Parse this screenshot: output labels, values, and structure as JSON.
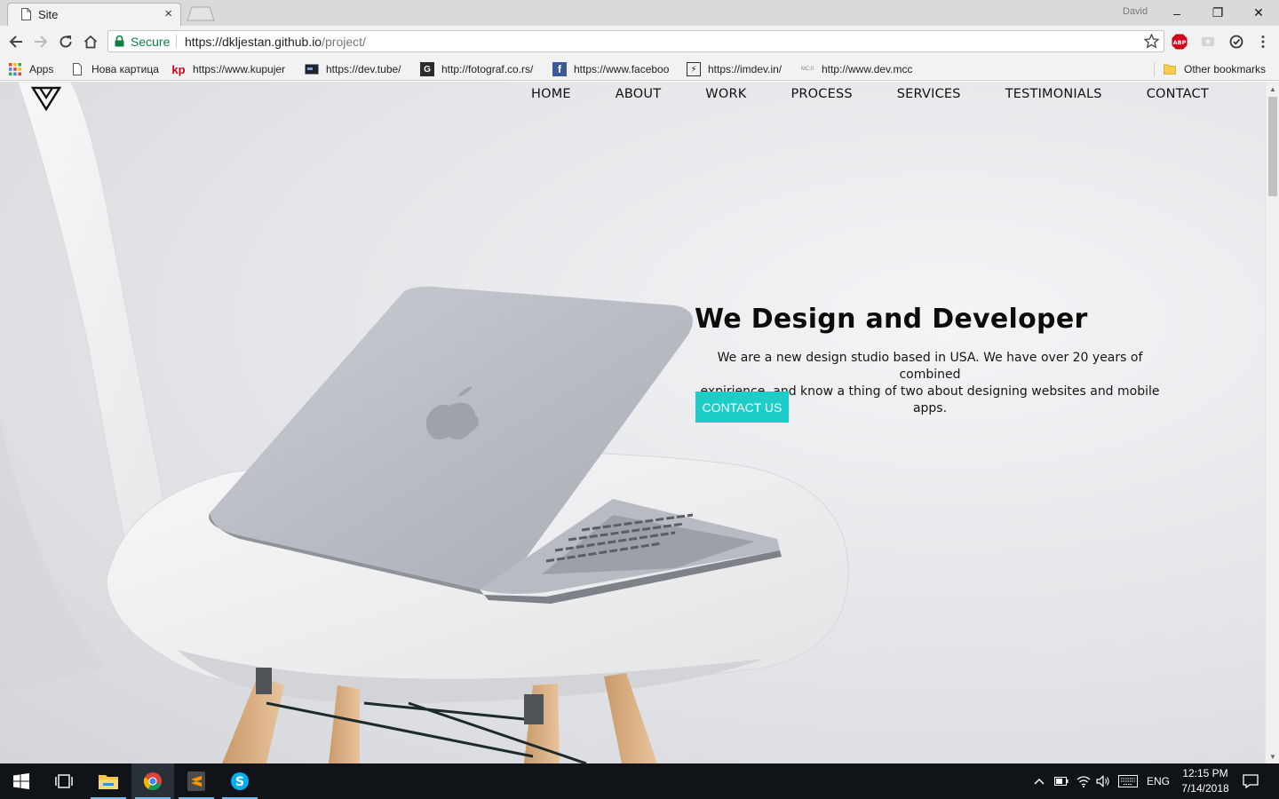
{
  "browser": {
    "tab": {
      "title": "Site",
      "close_glyph": "×",
      "icon": "document-icon"
    },
    "profile_name": "David",
    "window_controls": {
      "minimize": "–",
      "maximize": "❐",
      "close": "✕"
    },
    "address": {
      "secure_label": "Secure",
      "host": "https://dkljestan.github.io",
      "path": "/project/"
    },
    "bookmarks": [
      {
        "label": "Apps",
        "icon": "apps-grid-icon"
      },
      {
        "label": "Нова картица",
        "icon": "page-icon"
      },
      {
        "label": "https://www.kupujer",
        "icon": "kp-icon",
        "fav_text": "kp"
      },
      {
        "label": "https://dev.tube/",
        "icon": "devtube-icon"
      },
      {
        "label": "http://fotograf.co.rs/",
        "icon": "fotograf-icon",
        "fav_text": "G"
      },
      {
        "label": "https://www.faceboo",
        "icon": "facebook-icon",
        "fav_text": "f"
      },
      {
        "label": "https://imdev.in/",
        "icon": "imdev-icon",
        "fav_text": "⚡"
      },
      {
        "label": "http://www.dev.mcc",
        "icon": "mcc-icon",
        "fav_text": "MC.0"
      }
    ],
    "other_bookmarks": "Other bookmarks"
  },
  "site": {
    "nav": [
      "HOME",
      "ABOUT",
      "WORK",
      "PROCESS",
      "SERVICES",
      "TESTIMONIALS",
      "CONTACT"
    ],
    "hero": {
      "title": "We Design and Developer",
      "line1": "We are a new design studio based in USA. We have over 20 years of combined",
      "line2": "expirience, and know a thing of two about designing websites and mobile apps.",
      "cta": "CONTACT US"
    },
    "accent": "#1ccdc8"
  },
  "taskbar": {
    "language": "ENG",
    "time": "12:15 PM",
    "date": "7/14/2018",
    "apps": [
      "start-icon",
      "task-view-icon",
      "file-explorer-icon",
      "chrome-icon",
      "sublime-text-icon",
      "skype-icon"
    ]
  }
}
